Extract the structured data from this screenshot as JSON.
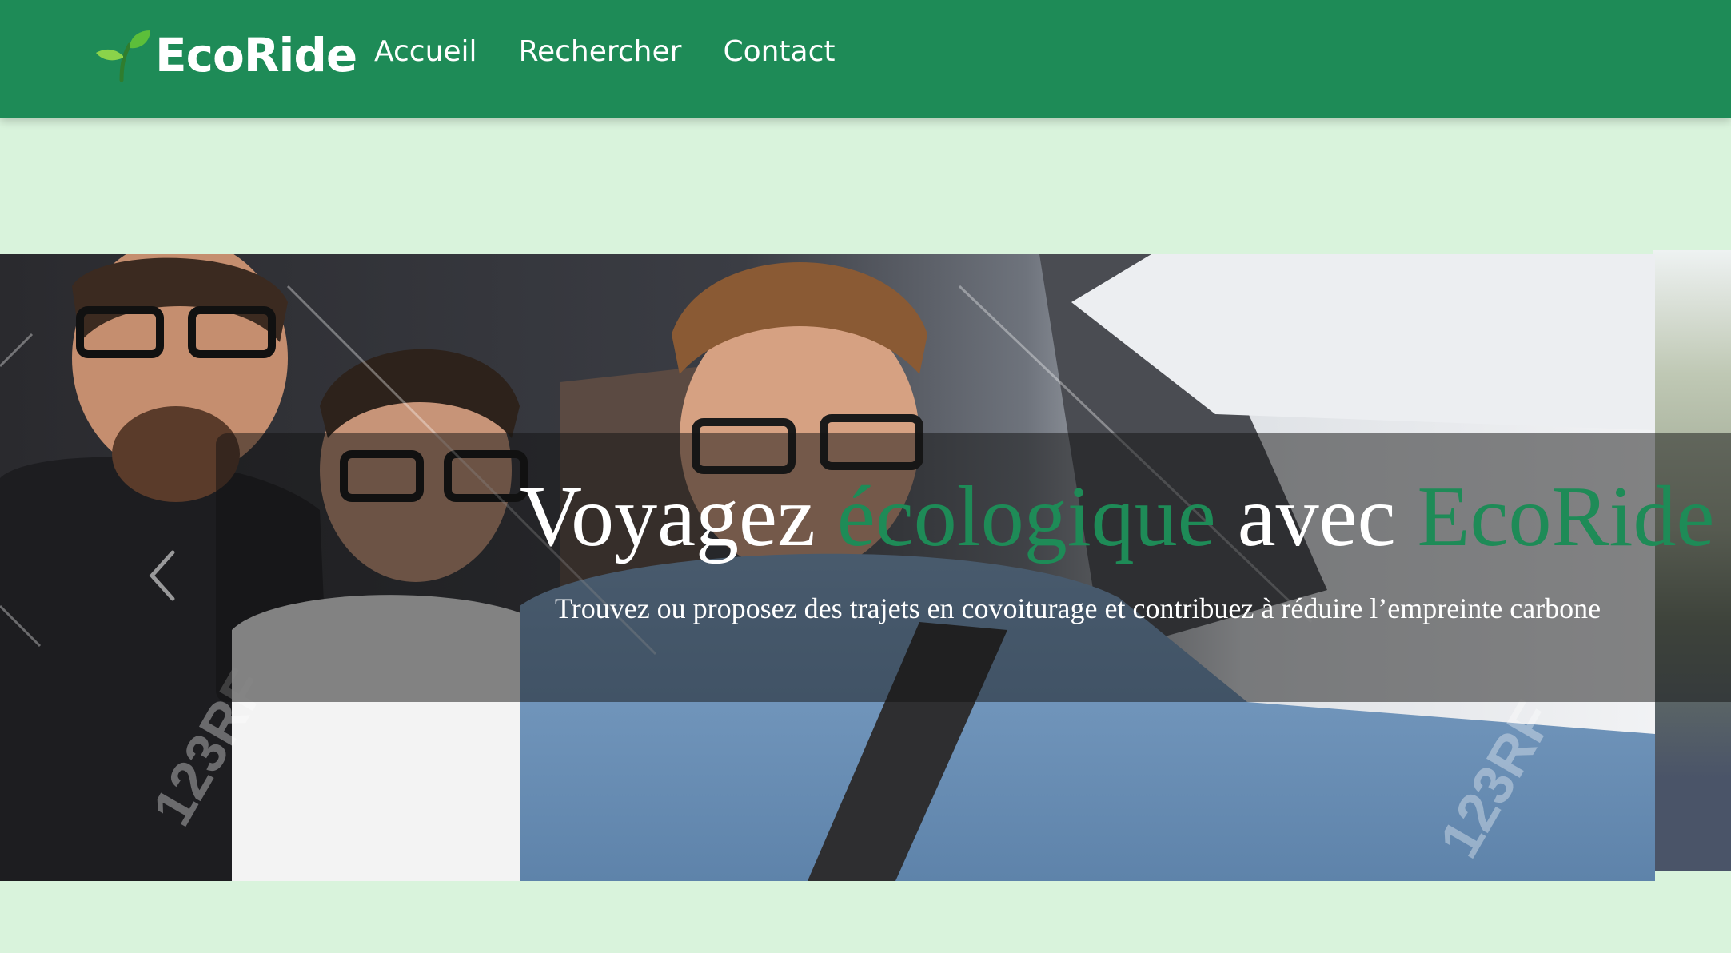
{
  "navbar": {
    "brand": "EcoRide",
    "brand_icon": "sprout-icon",
    "links": [
      {
        "label": "Accueil"
      },
      {
        "label": "Rechercher"
      },
      {
        "label": "Contact"
      }
    ],
    "background_color": "#1e8b57"
  },
  "hero": {
    "title_part1": "Voyagez ",
    "title_accent1": "écologique",
    "title_part2": " avec ",
    "title_accent2": "EcoRide",
    "subtitle": "Trouvez ou proposez des trajets en covoiturage et contribuez à réduire l’empreinte carbone",
    "image_watermark": "123RF",
    "prev_icon": "chevron-left-icon",
    "accent_color": "#1e8b57"
  },
  "page_background": "#d9f3dc"
}
